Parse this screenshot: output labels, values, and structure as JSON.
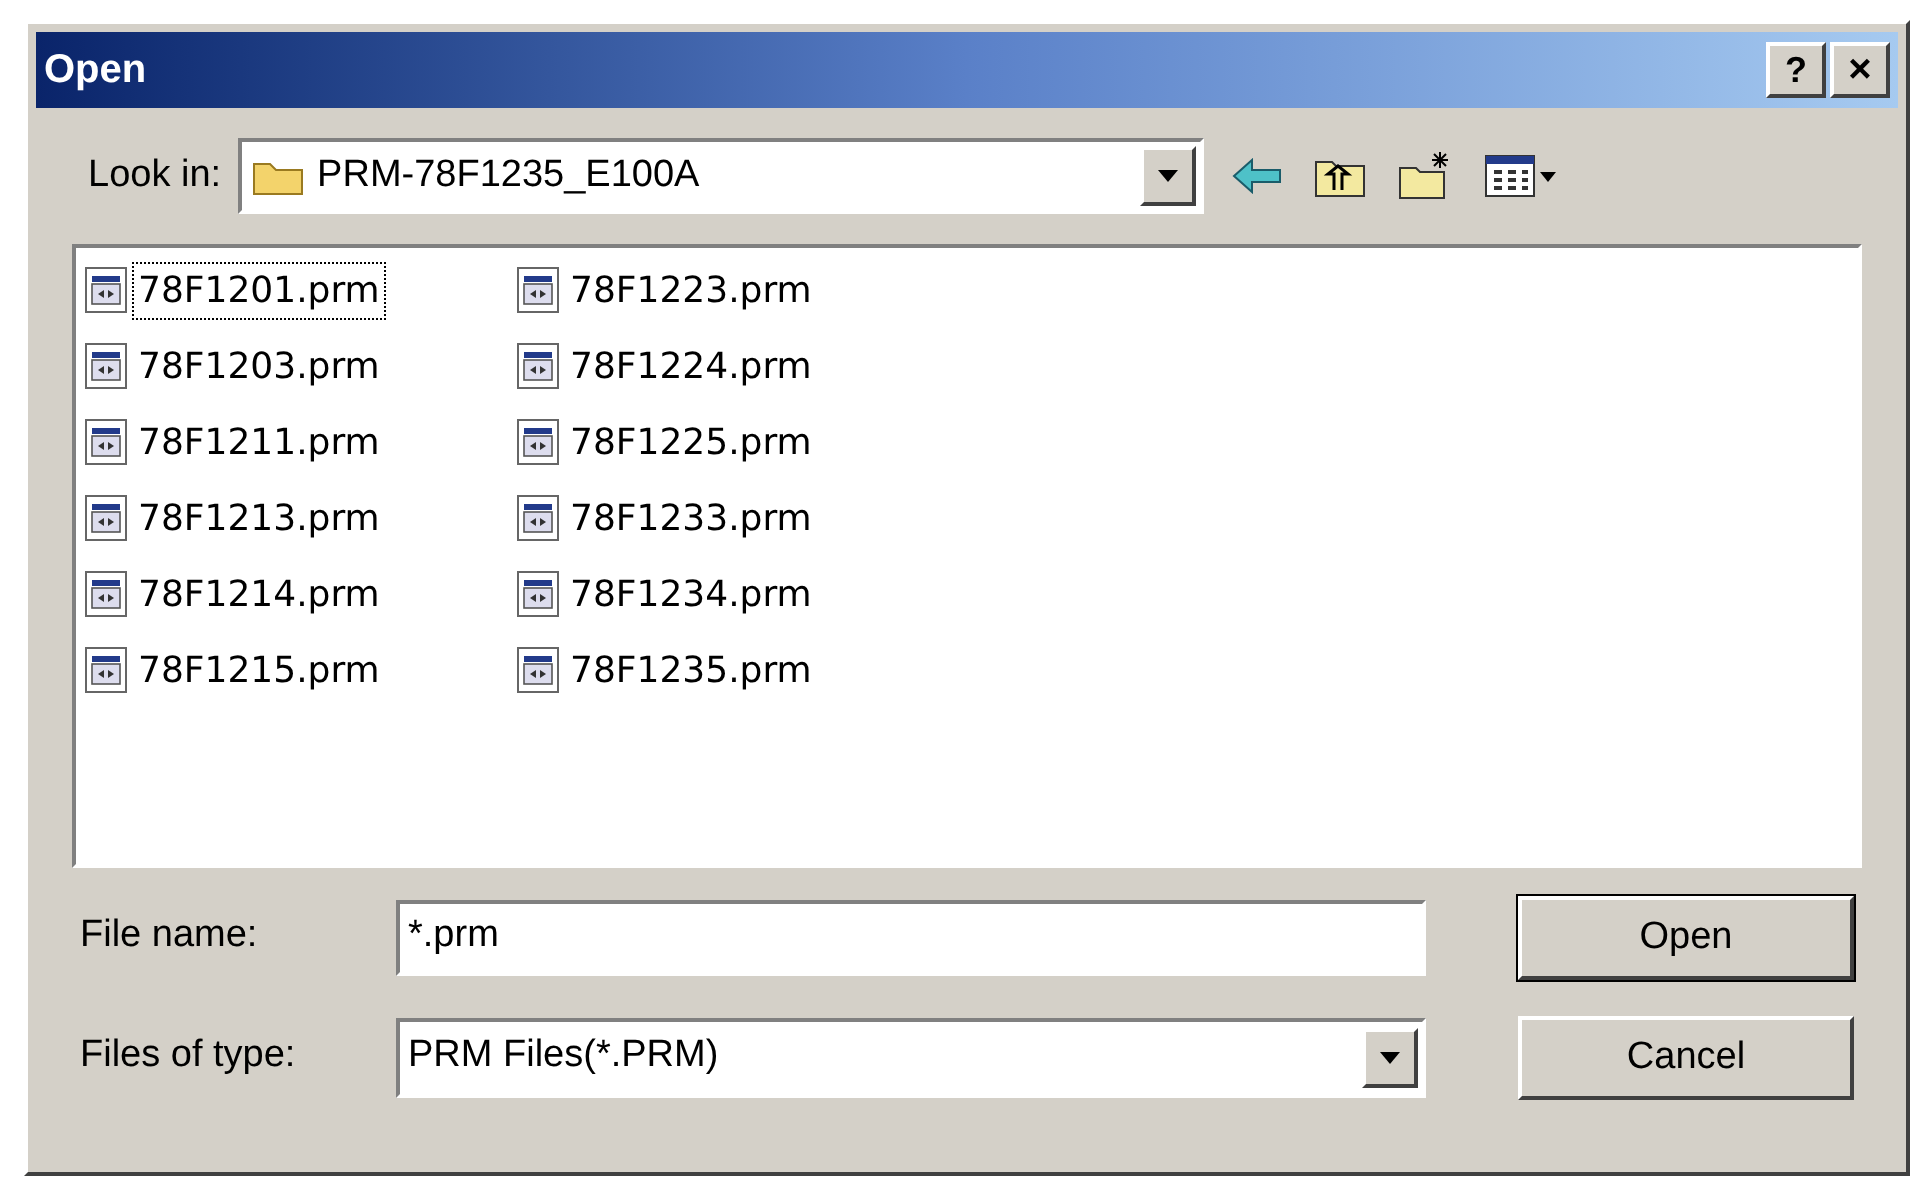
{
  "window": {
    "title": "Open",
    "help_button": "?",
    "close_button": "×"
  },
  "look_in": {
    "label": "Look in:",
    "value": "PRM-78F1235_E100A"
  },
  "files": [
    {
      "name": "78F1201.prm",
      "focused": true
    },
    {
      "name": "78F1203.prm",
      "focused": false
    },
    {
      "name": "78F1211.prm",
      "focused": false
    },
    {
      "name": "78F1213.prm",
      "focused": false
    },
    {
      "name": "78F1214.prm",
      "focused": false
    },
    {
      "name": "78F1215.prm",
      "focused": false
    },
    {
      "name": "78F1223.prm",
      "focused": false
    },
    {
      "name": "78F1224.prm",
      "focused": false
    },
    {
      "name": "78F1225.prm",
      "focused": false
    },
    {
      "name": "78F1233.prm",
      "focused": false
    },
    {
      "name": "78F1234.prm",
      "focused": false
    },
    {
      "name": "78F1235.prm",
      "focused": false
    }
  ],
  "file_name": {
    "label": "File name:",
    "value": "*.prm"
  },
  "files_of_type": {
    "label": "Files of type:",
    "value": "PRM Files(*.PRM)"
  },
  "buttons": [
    "Open",
    "Cancel"
  ]
}
